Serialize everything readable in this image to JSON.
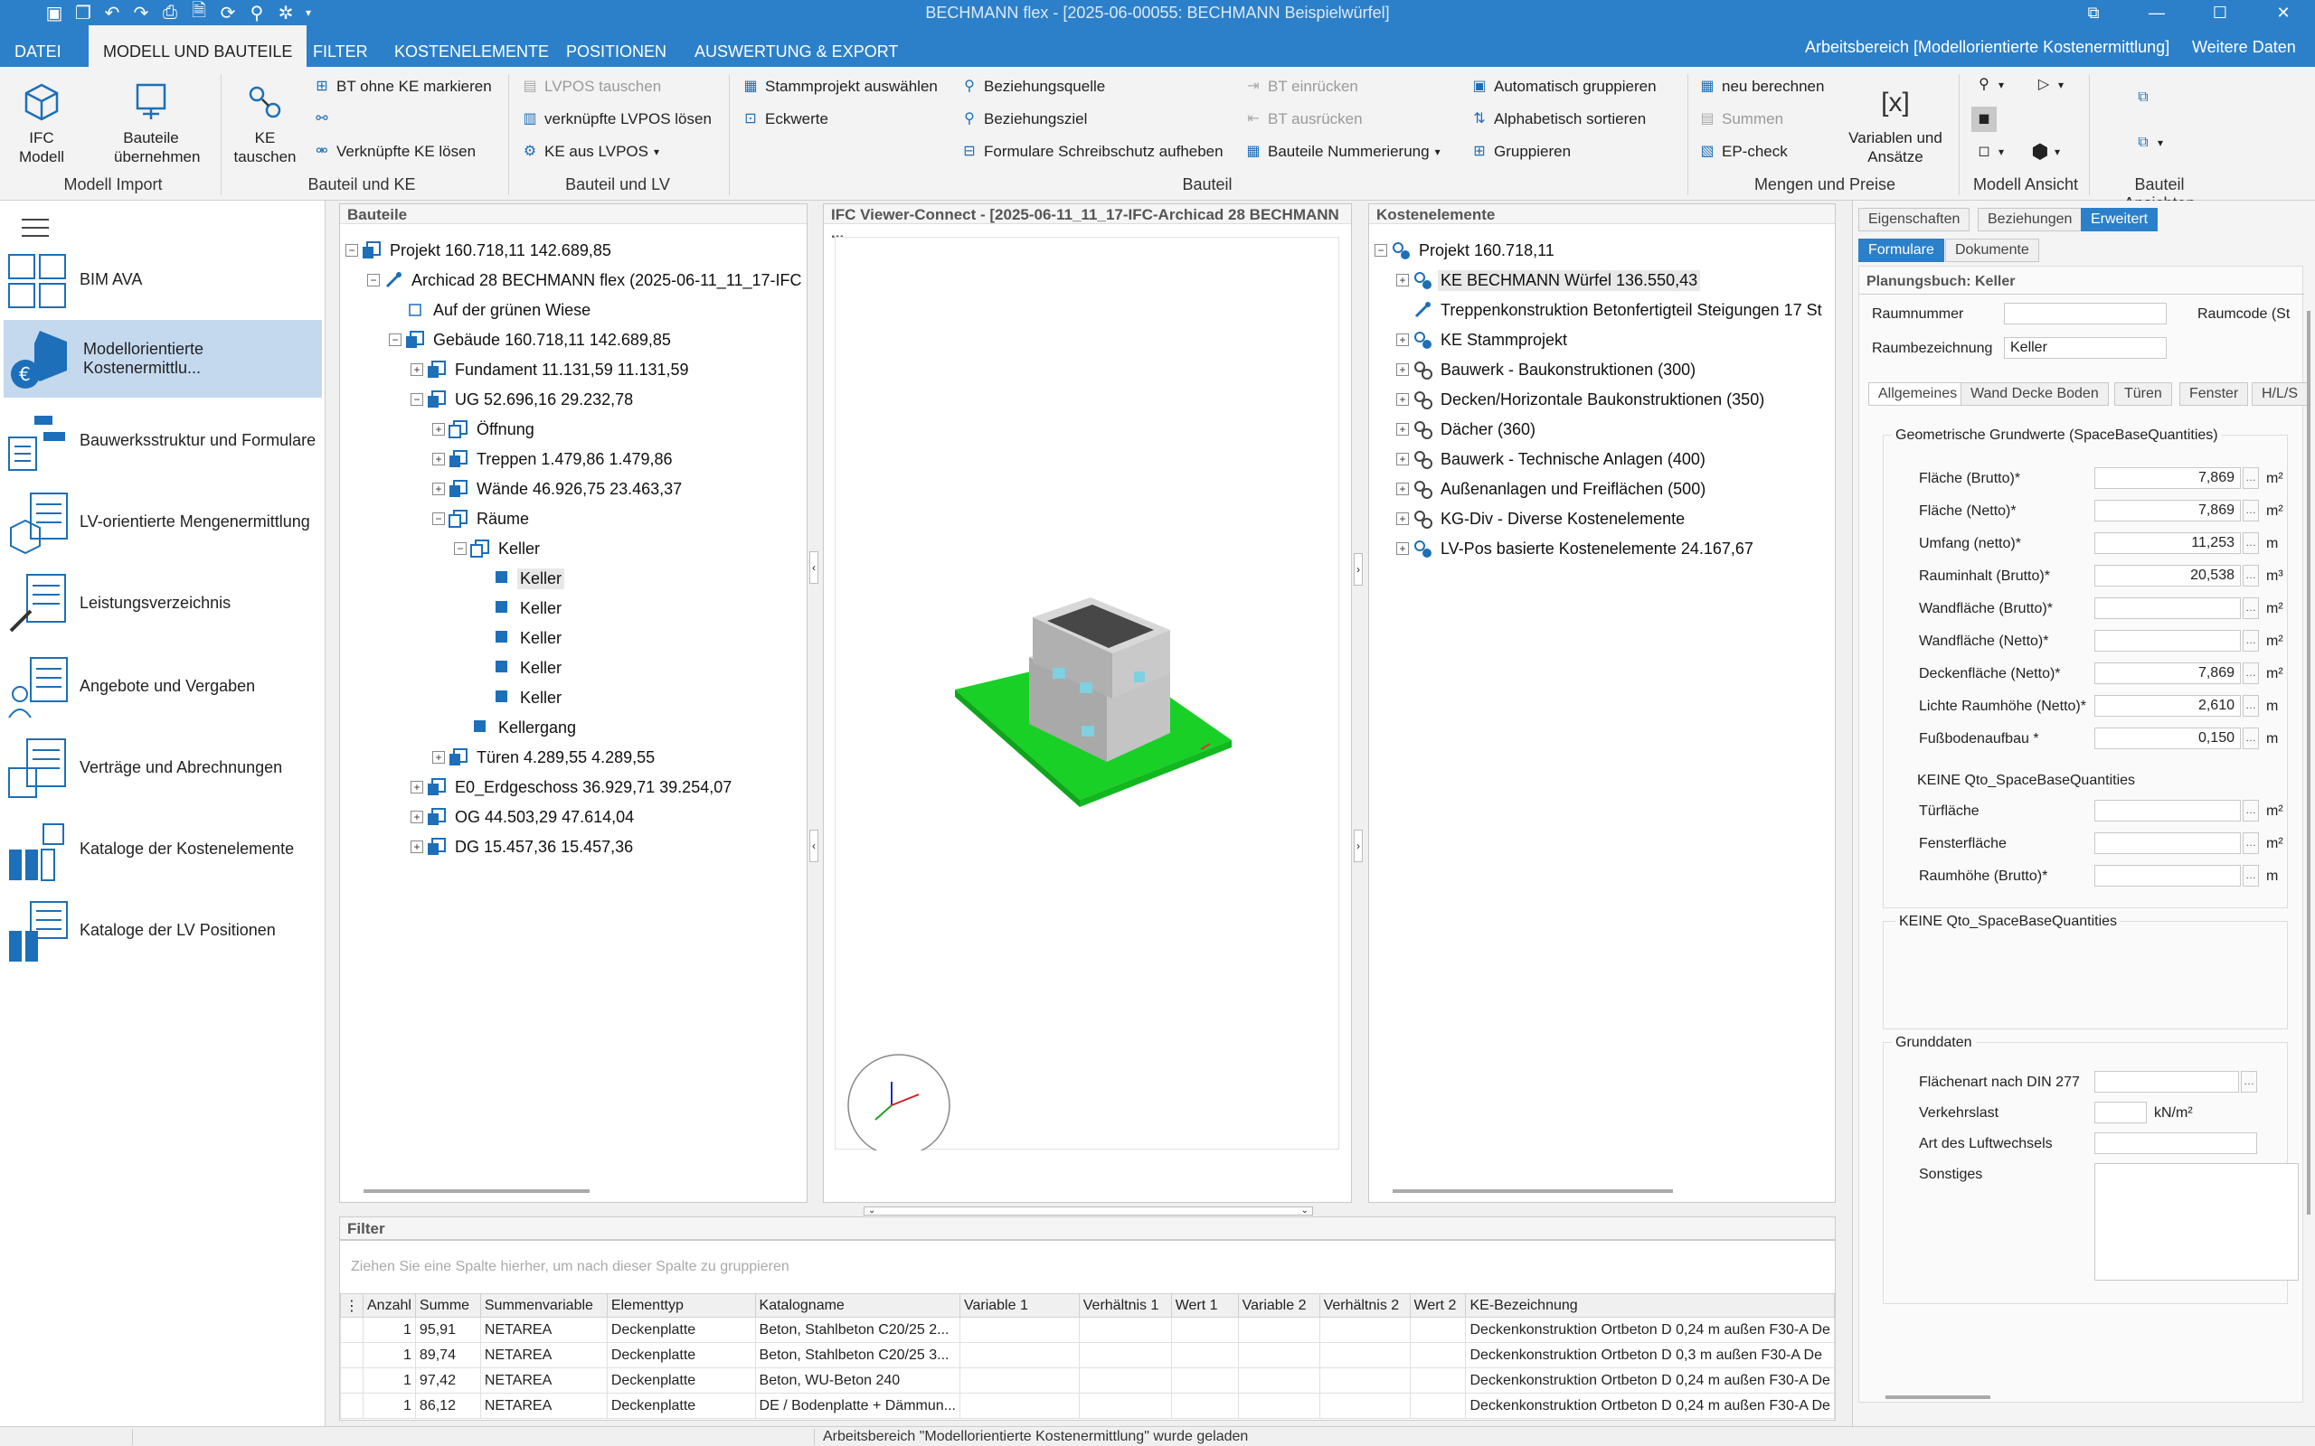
{
  "window": {
    "title": "BECHMANN flex - [2025-06-00055: BECHMANN Beispielwürfel]"
  },
  "menu": {
    "tabs": [
      "DATEI",
      "MODELL UND BAUTEILE",
      "FILTER",
      "KOSTENELEMENTE",
      "POSITIONEN",
      "AUSWERTUNG & EXPORT"
    ],
    "workspace": "Arbeitsbereich [Modellorientierte Kostenermittlung]",
    "more": "Weitere Daten"
  },
  "ribbon": {
    "ifc_model": "IFC Modell",
    "bauteile_uebernehmen": "Bauteile übernehmen",
    "ke_tauschen": "KE tauschen",
    "bt_ohne_ke": "BT ohne KE markieren",
    "verknuepfte_ke_loesen": "Verknüpfte KE lösen",
    "lvpos_tauschen": "LVPOS tauschen",
    "verknuepfte_lvpos_loesen": "verknüpfte LVPOS lösen",
    "ke_aus_lvpos": "KE aus LVPOS",
    "stammprojekt": "Stammprojekt auswählen",
    "eckwerte": "Eckwerte",
    "beziehungsquelle": "Beziehungsquelle",
    "beziehungsziel": "Beziehungsziel",
    "formulare_schreibschutz": "Formulare Schreibschutz aufheben",
    "bt_einruecken": "BT einrücken",
    "bt_ausruecken": "BT ausrücken",
    "bauteile_nummerierung": "Bauteile Nummerierung",
    "auto_gruppieren": "Automatisch gruppieren",
    "alpha_sortieren": "Alphabetisch sortieren",
    "gruppieren": "Gruppieren",
    "neu_berechnen": "neu berechnen",
    "summen": "Summen",
    "ep_check": "EP-check",
    "variablen": "Variablen und Ansätze",
    "groups": [
      "Modell Import",
      "Bauteil und KE",
      "Bauteil und LV",
      "Bauteil",
      "Mengen und Preise",
      "Modell Ansicht",
      "Bauteil Ansichten"
    ]
  },
  "sidebar": {
    "items": [
      "BIM AVA",
      "Modellorientierte Kostenermittlu...",
      "Bauwerksstruktur und Formulare",
      "LV-orientierte Mengenermittlung",
      "Leistungsverzeichnis",
      "Angebote und Vergaben",
      "Verträge und Abrechnungen",
      "Kataloge der Kostenelemente",
      "Kataloge der LV Positionen"
    ]
  },
  "bauteile": {
    "title": "Bauteile",
    "rows": [
      "Projekt  160.718,11  142.689,85",
      "Archicad 28 BECHMANN flex (2025-06-11_11_17-IFC",
      "Auf der grünen Wiese",
      "Gebäude  160.718,11  142.689,85",
      "Fundament  11.131,59  11.131,59",
      "UG  52.696,16  29.232,78",
      "Öffnung",
      "Treppen  1.479,86  1.479,86",
      "Wände  46.926,75  23.463,37",
      "Räume",
      "Keller",
      "Keller",
      "Keller",
      "Keller",
      "Keller",
      "Keller",
      "Kellergang",
      "Türen  4.289,55  4.289,55",
      "E0_Erdgeschoss  36.929,71  39.254,07",
      "OG  44.503,29  47.614,04",
      "DG  15.457,36  15.457,36"
    ]
  },
  "viewer": {
    "title": "IFC Viewer-Connect - [2025-06-11_11_17-IFC-Archicad 28 BECHMANN ..."
  },
  "kostenelemente": {
    "title": "Kostenelemente",
    "rows": [
      "Projekt  160.718,11",
      "KE BECHMANN Würfel  136.550,43",
      "Treppenkonstruktion Betonfertigteil Steigungen 17 St",
      "KE Stammprojekt",
      "Bauwerk - Baukonstruktionen (300)",
      "Decken/Horizontale Baukonstruktionen (350)",
      "Dächer (360)",
      "Bauwerk - Technische Anlagen (400)",
      "Außenanlagen und Freiflächen (500)",
      "KG-Div - Diverse Kostenelemente",
      "LV-Pos basierte Kostenelemente  24.167,67"
    ]
  },
  "props": {
    "tabs": [
      "Eigenschaften",
      "Beziehungen",
      "Erweitert"
    ],
    "subtabs": [
      "Formulare",
      "Dokumente"
    ],
    "heading": "Planungsbuch: Keller",
    "raumnummer_label": "Raumnummer",
    "raumcode_label": "Raumcode (St",
    "raumbez_label": "Raumbezeichnung",
    "raumbez_value": "Keller",
    "cattabs": [
      "Allgemeines",
      "Wand Decke Boden",
      "Türen",
      "Fenster",
      "H/L/S"
    ],
    "geo_title": "Geometrische Grundwerte (SpaceBaseQuantities)",
    "fields": [
      {
        "label": "Fläche (Brutto)*",
        "value": "7,869",
        "unit": "m²"
      },
      {
        "label": "Fläche (Netto)*",
        "value": "7,869",
        "unit": "m²"
      },
      {
        "label": "Umfang (netto)*",
        "value": "11,253",
        "unit": "m"
      },
      {
        "label": "Rauminhalt (Brutto)*",
        "value": "20,538",
        "unit": "m³"
      },
      {
        "label": "Wandfläche (Brutto)*",
        "value": "",
        "unit": "m²"
      },
      {
        "label": "Wandfläche (Netto)*",
        "value": "",
        "unit": "m²"
      },
      {
        "label": "Deckenfläche (Netto)*",
        "value": "7,869",
        "unit": "m²"
      },
      {
        "label": "Lichte Raumhöhe (Netto)*",
        "value": "2,610",
        "unit": "m"
      },
      {
        "label": "Fußbodenaufbau *",
        "value": "0,150",
        "unit": "m"
      }
    ],
    "keine1": "KEINE Qto_SpaceBaseQuantities",
    "fields2": [
      {
        "label": "Türfläche",
        "value": "",
        "unit": "m²"
      },
      {
        "label": "Fensterfläche",
        "value": "",
        "unit": "m²"
      },
      {
        "label": "Raumhöhe (Brutto)*",
        "value": "",
        "unit": "m"
      }
    ],
    "keine2": "KEINE Qto_SpaceBaseQuantities",
    "grund_title": "Grunddaten",
    "flaechenart": "Flächenart nach DIN 277",
    "verkehrslast": "Verkehrslast",
    "verkehrslast_unit": "kN/m²",
    "luftwechsel": "Art des Luftwechsels",
    "sonstiges": "Sonstiges"
  },
  "filter": {
    "title": "Filter",
    "hint": "Ziehen Sie eine Spalte hierher, um nach dieser Spalte zu gruppieren",
    "columns": [
      "Anzahl",
      "Summe",
      "Summenvariable",
      "Elementtyp",
      "Katalogname",
      "Variable 1",
      "Verhältnis 1",
      "Wert 1",
      "Variable 2",
      "Verhältnis 2",
      "Wert 2",
      "KE-Bezeichnung"
    ],
    "rows": [
      [
        "1",
        "95,91",
        "NETAREA",
        "Deckenplatte",
        "Beton, Stahlbeton C20/25 2...",
        "",
        "",
        "",
        "",
        "",
        "",
        "Deckenkonstruktion Ortbeton D 0,24 m außen F30-A De"
      ],
      [
        "1",
        "89,74",
        "NETAREA",
        "Deckenplatte",
        "Beton, Stahlbeton C20/25 3...",
        "",
        "",
        "",
        "",
        "",
        "",
        "Deckenkonstruktion Ortbeton D 0,3 m außen F30-A De"
      ],
      [
        "1",
        "97,42",
        "NETAREA",
        "Deckenplatte",
        "Beton, WU-Beton 240",
        "",
        "",
        "",
        "",
        "",
        "",
        "Deckenkonstruktion Ortbeton D 0,24 m außen F30-A De"
      ],
      [
        "1",
        "86,12",
        "NETAREA",
        "Deckenplatte",
        "DE / Bodenplatte + Dämmun...",
        "",
        "",
        "",
        "",
        "",
        "",
        "Deckenkonstruktion Ortbeton D 0,24 m außen F30-A De"
      ]
    ]
  },
  "status": {
    "text": "Arbeitsbereich \"Modellorientierte Kostenermittlung\" wurde geladen"
  }
}
